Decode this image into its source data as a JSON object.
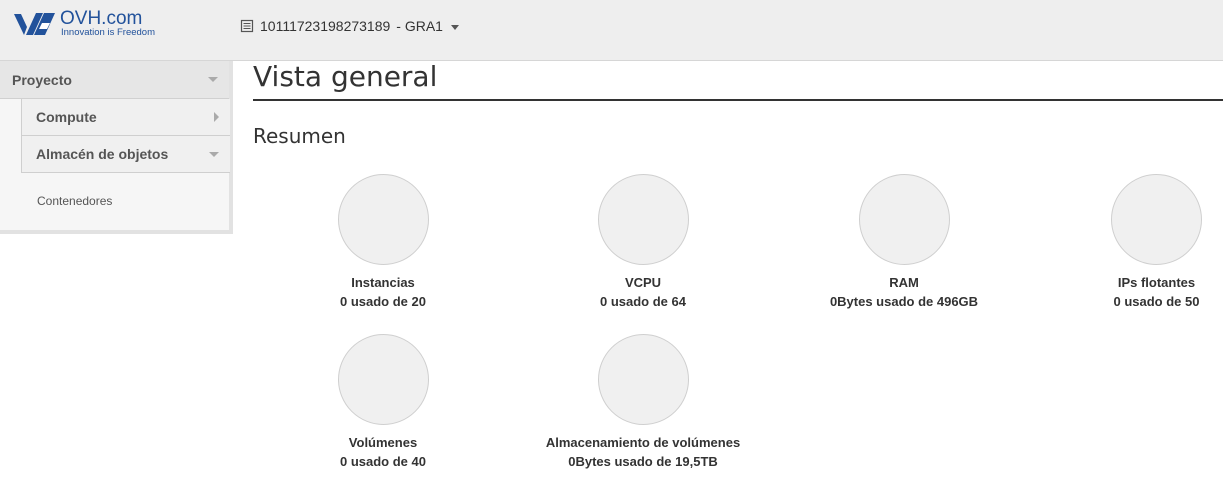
{
  "header": {
    "brand": "OVH.com",
    "tagline": "Innovation is Freedom",
    "project_id": "10111723198273189",
    "region": "- GRA1"
  },
  "sidebar": {
    "section": "Proyecto",
    "items": [
      {
        "label": "Compute",
        "icon": "chevron-right-icon"
      },
      {
        "label": "Almacén de objetos",
        "icon": "chevron-down-icon"
      }
    ],
    "leaf": "Contenedores"
  },
  "main": {
    "title": "Vista general",
    "section_title": "Resumen",
    "metrics": [
      {
        "name": "Instancias",
        "value": "0 usado de 20"
      },
      {
        "name": "VCPU",
        "value": "0 usado de 64"
      },
      {
        "name": "RAM",
        "value": "0Bytes usado de 496GB"
      },
      {
        "name": "IPs flotantes",
        "value": "0 usado de 50"
      },
      {
        "name": "Volúmenes",
        "value": "0 usado de 40"
      },
      {
        "name": "Almacenamiento de volúmenes",
        "value": "0Bytes usado de 19,5TB"
      }
    ]
  },
  "colors": {
    "brand": "#22529b",
    "topbar_bg": "#eeeeee",
    "circle_fill": "#f0f0f0"
  }
}
